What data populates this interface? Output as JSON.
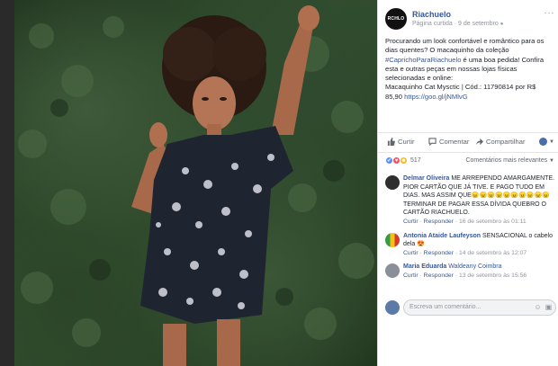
{
  "post": {
    "page_name": "Riachuelo",
    "avatar_text": "RCHLO",
    "meta_label": "Página curtida",
    "meta_sep": " · ",
    "date": "9 de setembro",
    "text_1": "Procurando um look confortável e romântico para os dias quentes? O macaquinho da coleção ",
    "hashtag": "#CaprichoParaRiachuelo",
    "text_2": " é uma boa pedida! Confira esta e outras peças em nossas lojas físicas selecionadas e online:",
    "product": "Macaquinho Cat Mysctic | Cód.: 11790814 por R$ 85,90 ",
    "url": "https://goo.gl/jNMlvG"
  },
  "actions": {
    "like": "Curtir",
    "comment": "Comentar",
    "share": "Compartilhar"
  },
  "reactions": {
    "count": "517",
    "sort": "Comentários mais relevantes"
  },
  "comments": [
    {
      "author": "Delmar Oliveira",
      "text": " ME ARREPENDO AMARGAMENTE. PIOR CARTÃO QUE JÁ TIVE. E PAGO TUDO EM DIAS. MAS ASSIM QUE😠😠😠😠😠😠😠😠😠😠 TERMINAR DE PAGAR ESSA DÍVIDA QUEBRO O CARTÃO RIACHUELO.",
      "like": "Curtir",
      "reply": "Responder",
      "time": "16 de setembro às 01:11"
    },
    {
      "author": "Antonia Ataide Laufeyson",
      "text": " SENSACIONAL o cabelo dela 😍",
      "like": "Curtir",
      "reply": "Responder",
      "time": "14 de setembro às 12:07"
    },
    {
      "author": "Maria Eduarda",
      "text": " Waldeany Coimbra",
      "like": "Curtir",
      "reply": "Responder",
      "time": "13 de setembro às 15:56"
    }
  ],
  "compose": {
    "placeholder": "Escreva um comentário..."
  },
  "colors": {
    "link": "#365899",
    "like_reaction": "#5890ff",
    "love_reaction": "#f25268",
    "haha_reaction": "#f7b928"
  }
}
